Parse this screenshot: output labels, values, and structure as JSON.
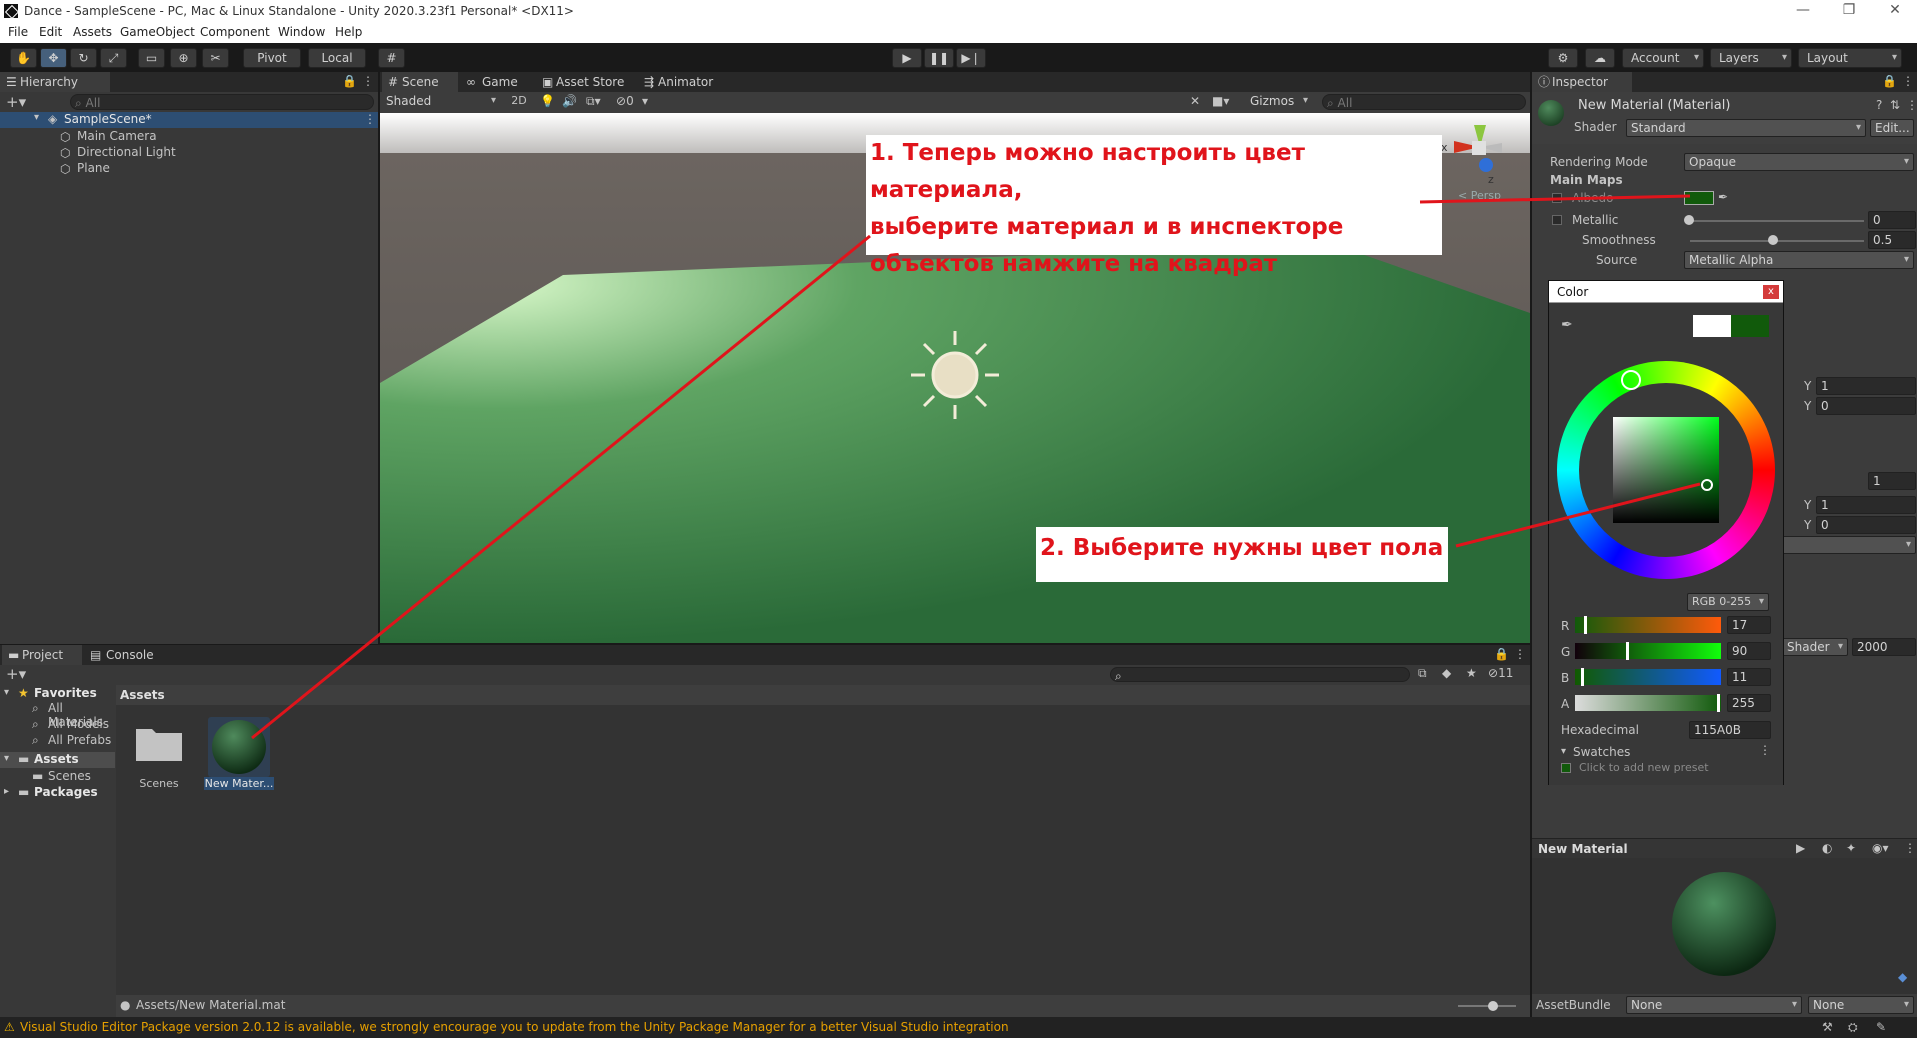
{
  "window": {
    "title": "Dance - SampleScene - PC, Mac & Linux Standalone - Unity 2020.3.23f1 Personal* <DX11>",
    "minimize": "—",
    "restore": "❐",
    "close": "✕"
  },
  "menu": [
    "File",
    "Edit",
    "Assets",
    "GameObject",
    "Component",
    "Window",
    "Help"
  ],
  "toolbar": {
    "pivot": "Pivot",
    "local": "Local",
    "account": "Account",
    "layers": "Layers",
    "layout": "Layout"
  },
  "hierarchy": {
    "tab": "Hierarchy",
    "search_placeholder": "All",
    "scene": "SampleScene*",
    "items": [
      "Main Camera",
      "Directional Light",
      "Plane"
    ]
  },
  "scene_view": {
    "tabs": [
      "Scene",
      "Game",
      "Asset Store",
      "Animator"
    ],
    "shading": "Shaded",
    "mode_2d": "2D",
    "hidden_count": "0",
    "gizmos": "Gizmos",
    "search_placeholder": "All",
    "projection": "Persp",
    "axis_x": "x",
    "axis_z": "z"
  },
  "annotations": {
    "step1": [
      "1. Теперь можно настроить цвет материала,",
      "выберите материал и в инспекторе",
      "объектов намжите на квадрат"
    ],
    "step2": "2. Выберите нужны цвет пола"
  },
  "project": {
    "tabs": [
      "Project",
      "Console"
    ],
    "favorites": "Favorites",
    "favorite_items": [
      "All Materials",
      "All Models",
      "All Prefabs"
    ],
    "assets_root": "Assets",
    "assets_children": [
      "Scenes"
    ],
    "packages": "Packages",
    "breadcrumb": "Assets",
    "tiles": [
      "Scenes",
      "New Mater..."
    ],
    "hidden_packages": "11",
    "path": "Assets/New Material.mat"
  },
  "inspector": {
    "tab": "Inspector",
    "title": "New Material (Material)",
    "shader_label": "Shader",
    "shader": "Standard",
    "edit": "Edit...",
    "rendering_mode_label": "Rendering Mode",
    "rendering_mode": "Opaque",
    "main_maps": "Main Maps",
    "albedo": "Albedo",
    "metallic_label": "Metallic",
    "metallic": "0",
    "smoothness_label": "Smoothness",
    "smoothness": "0.5",
    "source_label": "Source",
    "source": "Metallic Alpha",
    "y1": "1",
    "y2": "0",
    "y3": "1",
    "y4": "0",
    "mid_value": "1",
    "y_letter": "Y",
    "render_queue_source": "Shader",
    "render_queue": "2000",
    "preview_title": "New Material",
    "assetbundle_label": "AssetBundle",
    "assetbundle": "None",
    "variant": "None",
    "albedo_color": "#115A0B"
  },
  "color_picker": {
    "title": "Color",
    "close": "x",
    "mode": "RGB 0-255",
    "channels": [
      {
        "name": "R",
        "value": "17"
      },
      {
        "name": "G",
        "value": "90"
      },
      {
        "name": "B",
        "value": "11"
      },
      {
        "name": "A",
        "value": "255"
      }
    ],
    "hex_label": "Hexadecimal",
    "hex": "115A0B",
    "swatches": "Swatches",
    "swatch_hint": "Click to add new preset",
    "current_color": "#115A0B",
    "previous_color": "#FFFFFF"
  },
  "status": "Visual Studio Editor Package version 2.0.12 is available, we strongly encourage you to update from the Unity Package Manager for a better Visual Studio integration"
}
